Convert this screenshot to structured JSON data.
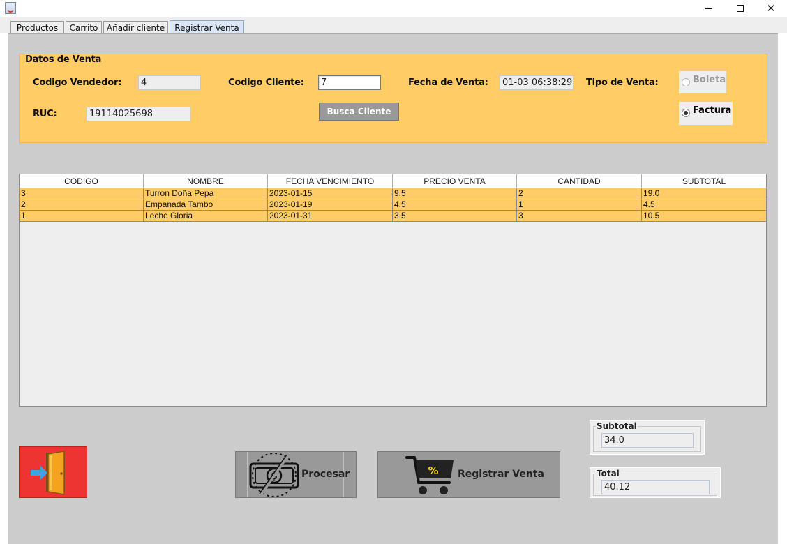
{
  "window": {
    "minimize_symbol": "",
    "close_symbol": "✕"
  },
  "tabs": [
    {
      "label": "Productos"
    },
    {
      "label": "Carrito"
    },
    {
      "label": "Añadir cliente"
    },
    {
      "label": "Registrar Venta"
    }
  ],
  "datos_venta": {
    "title": "Datos de Venta",
    "codigo_vendedor_label": "Codigo Vendedor:",
    "codigo_vendedor_value": "4",
    "codigo_cliente_label": "Codigo Cliente:",
    "codigo_cliente_value": "7",
    "fecha_label": "Fecha de Venta:",
    "fecha_value": "01-03 06:38:29",
    "tipo_label": "Tipo de Venta:",
    "ruc_label": "RUC:",
    "ruc_value": "19114025698",
    "busca_button": "Busca Cliente",
    "boleta_label": "Boleta",
    "factura_label": "Factura",
    "selected": "Factura"
  },
  "table": {
    "headers": [
      "CODIGO",
      "NOMBRE",
      "FECHA VENCIMIENTO",
      "PRECIO VENTA",
      "CANTIDAD",
      "SUBTOTAL"
    ],
    "rows": [
      [
        "3",
        "Turron Doña Pepa",
        "2023-01-15",
        "9.5",
        "2",
        "19.0"
      ],
      [
        "2",
        "Empanada Tambo",
        "2023-01-19",
        "4.5",
        "1",
        "4.5"
      ],
      [
        "1",
        "Leche Gloria",
        "2023-01-31",
        "3.5",
        "3",
        "10.5"
      ]
    ]
  },
  "actions": {
    "procesar_label": "Procesar",
    "registrar_label": "Registrar Venta"
  },
  "totals": {
    "subtotal_title": "Subtotal",
    "subtotal_value": "34.0",
    "total_title": "Total",
    "total_value": "40.12"
  },
  "colors": {
    "accent_orange": "#ffcc66",
    "exit_red": "#ee3333",
    "button_gray": "#999999",
    "panel_gray": "#cccccc"
  },
  "icons": {
    "exit": "exit-door-icon",
    "procesar": "money-icon",
    "registrar": "cart-icon"
  }
}
